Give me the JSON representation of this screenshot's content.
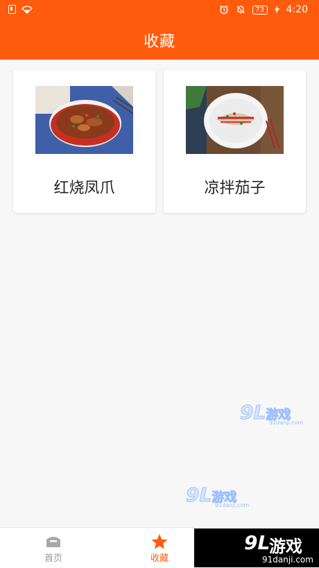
{
  "status_bar": {
    "battery": "73",
    "time": "4:20",
    "icons": [
      "sim-icon",
      "wifi-icon",
      "alarm-icon",
      "bell-off-icon",
      "battery-icon",
      "charging-icon"
    ]
  },
  "header": {
    "title": "收藏",
    "color": "#ff5b0d"
  },
  "favorites": [
    {
      "title": "红烧凤爪"
    },
    {
      "title": "凉拌茄子"
    }
  ],
  "bottom_nav": {
    "items": [
      {
        "label": "首页",
        "icon": "home-icon",
        "active": false
      },
      {
        "label": "收藏",
        "icon": "star-icon",
        "active": true
      }
    ],
    "active_color": "#ff5b0d"
  },
  "watermarks": {
    "logo": "9L",
    "name": "游戏",
    "url": "91danji.com"
  }
}
